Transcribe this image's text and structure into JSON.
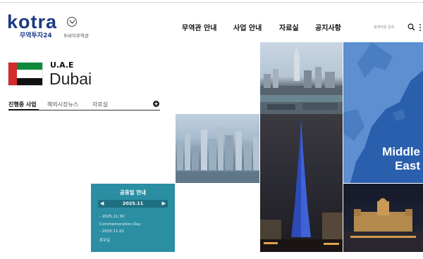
{
  "header": {
    "logo": "kotra",
    "logo_sub": "무역투자24",
    "logo_sub_small": "두바이무역관",
    "nav": [
      "무역관 안내",
      "사업 안내",
      "자료실",
      "공지사항"
    ],
    "search_placeholder": "검색어를 입력"
  },
  "country": {
    "code": "U.A.E",
    "city": "Dubai",
    "flag_colors": {
      "red": "#d42a2a",
      "green": "#0e8a3c",
      "white": "#ffffff",
      "black": "#111111"
    }
  },
  "tabs": [
    "진행중 사업",
    "해외시장뉴스",
    "자료실"
  ],
  "holiday": {
    "title": "공휴일 안내",
    "month": "2025.11",
    "prev": "◀",
    "next": "▶",
    "events": [
      "- 2025.11.30",
      "Commemoration Day",
      "- 2025.11.01",
      "휴무일"
    ]
  },
  "map": {
    "line1": "Middle",
    "line2": "East"
  },
  "colors": {
    "brand": "#1b3a84",
    "holiday_bg": "#2b8ea3",
    "map_bg": "#2a5fae"
  }
}
